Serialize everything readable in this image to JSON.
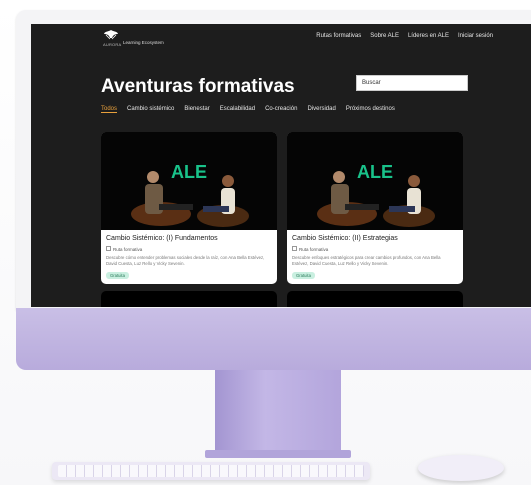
{
  "colors": {
    "screen_bg": "#1d1d1d",
    "active_filter": "#e8a03c",
    "badge_bg": "#c9efe0",
    "ale_logo": "#19c28a"
  },
  "nav": {
    "logo_text": "AURORA",
    "brand_sub": "Learning Ecosystem",
    "links": [
      "Rutas formativas",
      "Sobre ALE",
      "Líderes en ALE",
      "Iniciar sesión"
    ]
  },
  "page": {
    "title": "Aventuras formativas",
    "search_placeholder": "Buscar"
  },
  "filters": [
    "Todos",
    "Cambio sistémico",
    "Bienestar",
    "Escalabilidad",
    "Co-creación",
    "Diversidad",
    "Próximos destinos"
  ],
  "active_filter_index": 0,
  "cards": [
    {
      "title": "Cambio Sistémico: (I) Fundamentos",
      "type": "Ruta formativa",
      "description": "Descubre cómo entender problemas sociales desde la raíz, con Ana Bella Estévez, David Cuesta, Luz Rello y Vicky Sevenin.",
      "badge": "Gratuita",
      "thumb_logo": "ALE"
    },
    {
      "title": "Cambio Sistémico: (II) Estrategias",
      "type": "Ruta formativa",
      "description": "Descubre enfoques estratégicos para crear cambios profundos, con Ana Bella Estévez, David Cuesta, Luz Rello y Vicky Sevenin.",
      "badge": "Gratuita",
      "thumb_logo": "ALE"
    }
  ]
}
